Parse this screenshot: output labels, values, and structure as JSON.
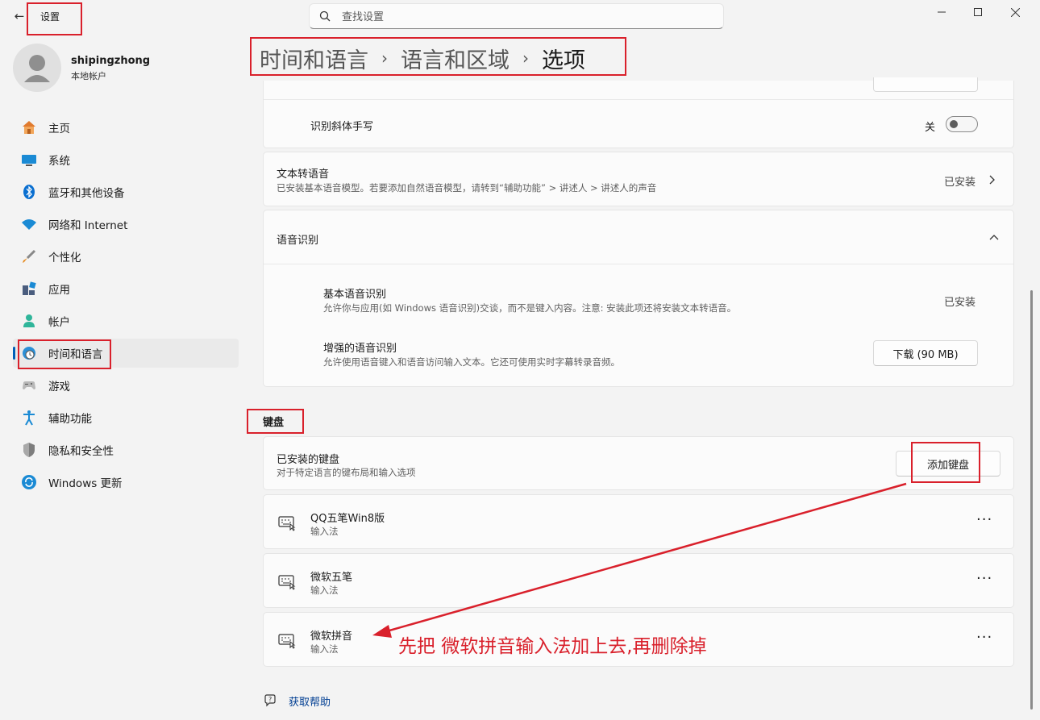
{
  "app": {
    "title": "设置",
    "search_placeholder": "查找设置"
  },
  "user": {
    "name": "shipingzhong",
    "account_type": "本地帐户"
  },
  "nav": {
    "items": [
      {
        "label": "主页",
        "icon": "home-icon"
      },
      {
        "label": "系统",
        "icon": "system-icon"
      },
      {
        "label": "蓝牙和其他设备",
        "icon": "bluetooth-icon"
      },
      {
        "label": "网络和 Internet",
        "icon": "wifi-icon"
      },
      {
        "label": "个性化",
        "icon": "brush-icon"
      },
      {
        "label": "应用",
        "icon": "apps-icon"
      },
      {
        "label": "帐户",
        "icon": "account-icon"
      },
      {
        "label": "时间和语言",
        "icon": "time-language-icon"
      },
      {
        "label": "游戏",
        "icon": "gamepad-icon"
      },
      {
        "label": "辅助功能",
        "icon": "accessibility-icon"
      },
      {
        "label": "隐私和安全性",
        "icon": "shield-icon"
      },
      {
        "label": "Windows 更新",
        "icon": "update-icon"
      }
    ],
    "active": "时间和语言"
  },
  "breadcrumb": [
    "时间和语言",
    "语言和区域",
    "选项"
  ],
  "content": {
    "handwriting_slant": {
      "label": "识别斜体手写",
      "toggle_state": "关"
    },
    "tts": {
      "title": "文本转语音",
      "description": "已安装基本语音模型。若要添加自然语音模型，请转到“辅助功能” > 讲述人 > 讲述人的声音",
      "status": "已安装"
    },
    "speech_recognition": {
      "title": "语音识别",
      "basic": {
        "title": "基本语音识别",
        "description": "允许你与应用(如 Windows 语音识别)交谈，而不是键入内容。注意: 安装此项还将安装文本转语音。",
        "status": "已安装"
      },
      "enhanced": {
        "title": "增强的语音识别",
        "description": "允许使用语音键入和语音访问输入文本。它还可使用实时字幕转录音频。",
        "button": "下载 (90 MB)"
      }
    },
    "keyboard_section": "键盘",
    "installed_keyboards": {
      "title": "已安装的键盘",
      "description": "对于特定语言的键布局和输入选项",
      "add_button": "添加键盘"
    },
    "keyboards": [
      {
        "name": "QQ五笔Win8版",
        "type": "输入法"
      },
      {
        "name": "微软五笔",
        "type": "输入法"
      },
      {
        "name": "微软拼音",
        "type": "输入法"
      }
    ],
    "more_label": "···",
    "help": "获取帮助"
  },
  "annotation": {
    "text": "先把 微软拼音输入法加上去,再删除掉",
    "color": "#d9202b"
  }
}
